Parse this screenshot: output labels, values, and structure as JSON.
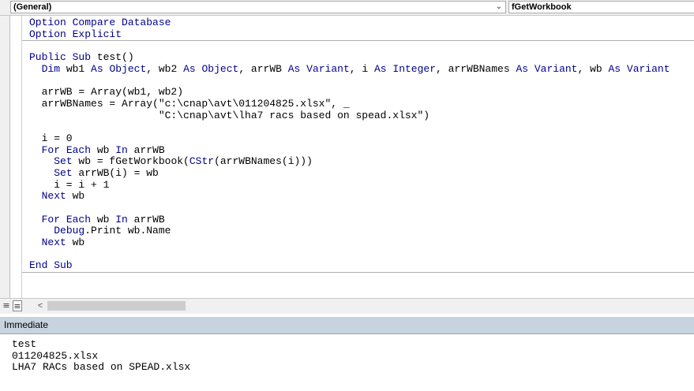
{
  "toolbar": {
    "object_combo": "(General)",
    "procedure_combo": "fGetWorkbook"
  },
  "code_lines": [
    [
      {
        "t": "Option Compare Database",
        "k": 1
      }
    ],
    [
      {
        "t": "Option Explicit",
        "k": 1
      }
    ],
    [],
    [
      {
        "t": "Public Sub",
        "k": 1
      },
      {
        "t": " test()"
      }
    ],
    [
      {
        "t": "  "
      },
      {
        "t": "Dim",
        "k": 1
      },
      {
        "t": " wb1 "
      },
      {
        "t": "As",
        "k": 1
      },
      {
        "t": " "
      },
      {
        "t": "Object",
        "k": 1
      },
      {
        "t": ", wb2 "
      },
      {
        "t": "As",
        "k": 1
      },
      {
        "t": " "
      },
      {
        "t": "Object",
        "k": 1
      },
      {
        "t": ", arrWB "
      },
      {
        "t": "As",
        "k": 1
      },
      {
        "t": " "
      },
      {
        "t": "Variant",
        "k": 1
      },
      {
        "t": ", i "
      },
      {
        "t": "As",
        "k": 1
      },
      {
        "t": " "
      },
      {
        "t": "Integer",
        "k": 1
      },
      {
        "t": ", arrWBNames "
      },
      {
        "t": "As",
        "k": 1
      },
      {
        "t": " "
      },
      {
        "t": "Variant",
        "k": 1
      },
      {
        "t": ", wb "
      },
      {
        "t": "As",
        "k": 1
      },
      {
        "t": " "
      },
      {
        "t": "Variant",
        "k": 1
      }
    ],
    [],
    [
      {
        "t": "  arrWB = Array(wb1, wb2)"
      }
    ],
    [
      {
        "t": "  arrWBNames = Array(\"c:\\cnap\\avt\\011204825.xlsx\", _"
      }
    ],
    [
      {
        "t": "                     \"C:\\cnap\\avt\\lha7 racs based on spead.xlsx\")"
      }
    ],
    [],
    [
      {
        "t": "  i = 0"
      }
    ],
    [
      {
        "t": "  "
      },
      {
        "t": "For Each",
        "k": 1
      },
      {
        "t": " wb "
      },
      {
        "t": "In",
        "k": 1
      },
      {
        "t": " arrWB"
      }
    ],
    [
      {
        "t": "    "
      },
      {
        "t": "Set",
        "k": 1
      },
      {
        "t": " wb = fGetWorkbook("
      },
      {
        "t": "CStr",
        "k": 1
      },
      {
        "t": "(arrWBNames(i)))"
      }
    ],
    [
      {
        "t": "    "
      },
      {
        "t": "Set",
        "k": 1
      },
      {
        "t": " arrWB(i) = wb"
      }
    ],
    [
      {
        "t": "    i = i + 1"
      }
    ],
    [
      {
        "t": "  "
      },
      {
        "t": "Next",
        "k": 1
      },
      {
        "t": " wb"
      }
    ],
    [],
    [
      {
        "t": "  "
      },
      {
        "t": "For Each",
        "k": 1
      },
      {
        "t": " wb "
      },
      {
        "t": "In",
        "k": 1
      },
      {
        "t": " arrWB"
      }
    ],
    [
      {
        "t": "    "
      },
      {
        "t": "Debug",
        "k": 1
      },
      {
        "t": ".Print wb.Name"
      }
    ],
    [
      {
        "t": "  "
      },
      {
        "t": "Next",
        "k": 1
      },
      {
        "t": " wb"
      }
    ],
    [],
    [
      {
        "t": "End Sub",
        "k": 1
      }
    ]
  ],
  "immediate": {
    "title": "Immediate",
    "lines": [
      "test",
      "011204825.xlsx",
      "LHA7 RACs based on SPEAD.xlsx"
    ]
  },
  "colors": {
    "keyword": "#00008b",
    "immediate_header": "#c7d3df"
  },
  "icons": {
    "dropdown": "chevron-down-icon",
    "procedure_view": "procedure-view-icon",
    "full_module_view": "full-module-view-icon",
    "scroll_left": "scroll-left-icon"
  }
}
